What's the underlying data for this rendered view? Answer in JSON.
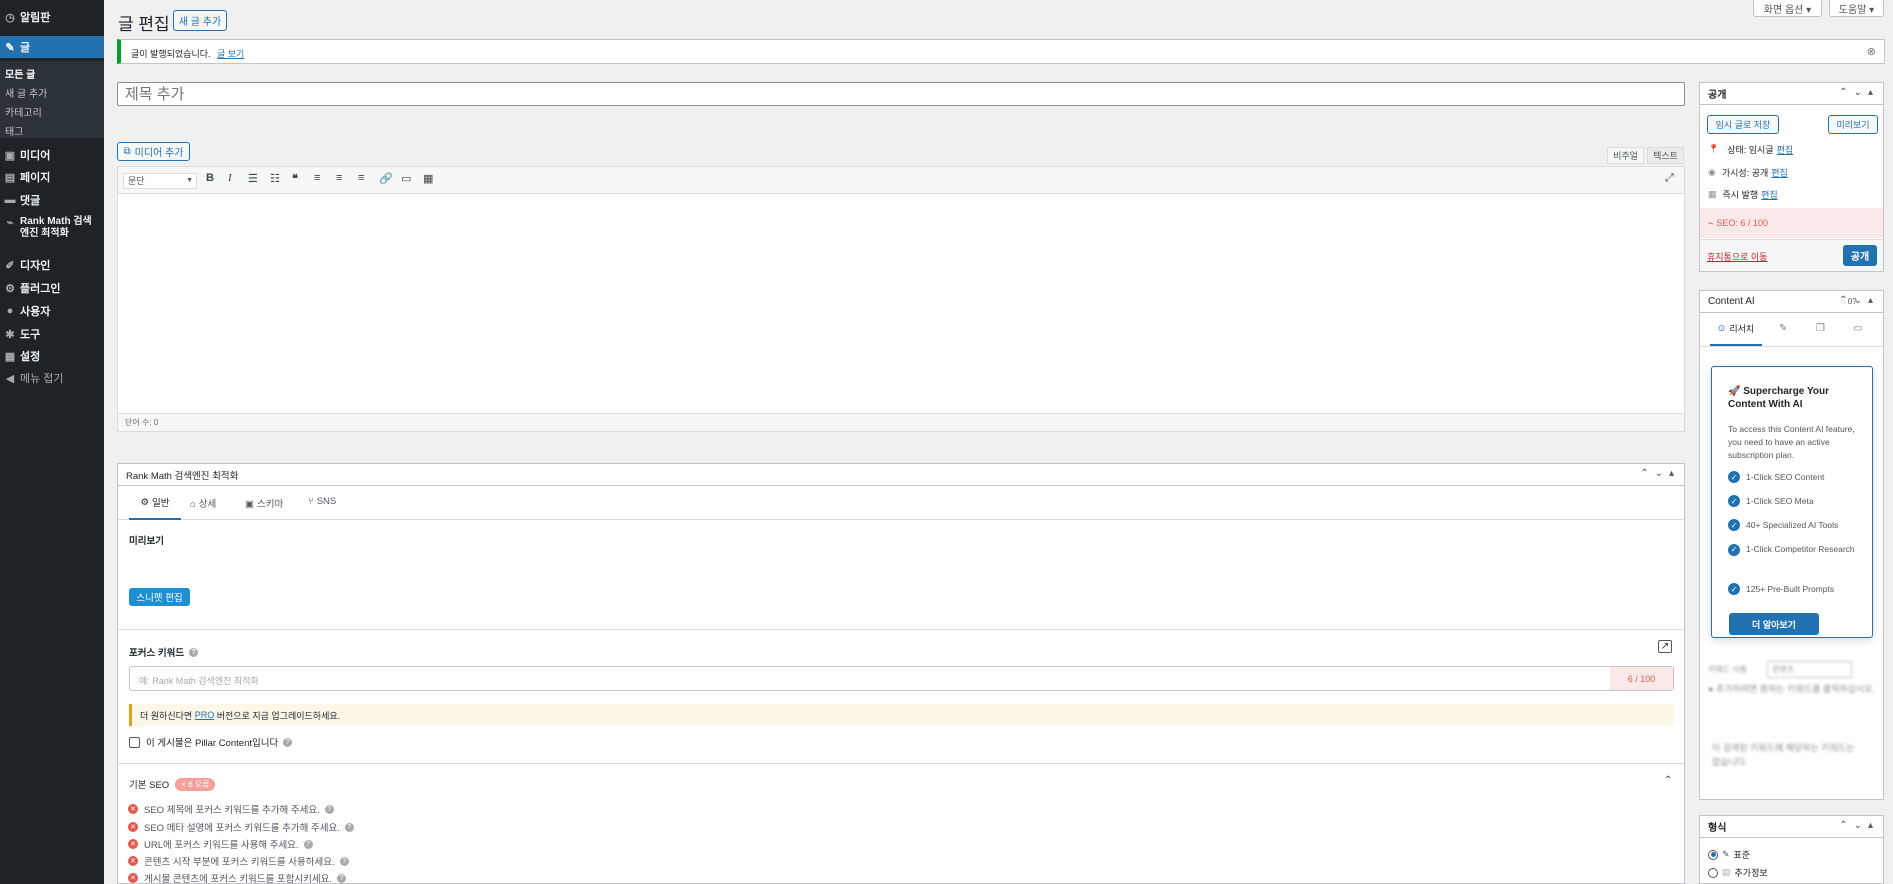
{
  "sidebar": {
    "items": [
      {
        "icon": "dashboard-icon",
        "glyph": "◷",
        "label": "알림판"
      },
      {
        "icon": "pin-icon",
        "glyph": "✎",
        "label": "글"
      },
      {
        "icon": "media-icon",
        "glyph": "▣",
        "label": "미디어"
      },
      {
        "icon": "page-icon",
        "glyph": "▤",
        "label": "페이지"
      },
      {
        "icon": "comment-icon",
        "glyph": "▬",
        "label": "댓글"
      },
      {
        "icon": "rankmath-icon",
        "glyph": "⌁",
        "label": "Rank Math 검색엔진 최적화"
      },
      {
        "icon": "brush-icon",
        "glyph": "✐",
        "label": "디자인"
      },
      {
        "icon": "plugin-icon",
        "glyph": "⚙",
        "label": "플러그인"
      },
      {
        "icon": "user-icon",
        "glyph": "●",
        "label": "사용자"
      },
      {
        "icon": "wrench-icon",
        "glyph": "✱",
        "label": "도구"
      },
      {
        "icon": "settings-icon",
        "glyph": "▦",
        "label": "설정"
      },
      {
        "icon": "collapse-icon",
        "glyph": "◀",
        "label": "메뉴 접기"
      }
    ],
    "submenu": [
      "모든 글",
      "새 글 추가",
      "카테고리",
      "태그"
    ]
  },
  "header": {
    "title": "글 편집",
    "add_new": "새 글 추가",
    "screen_options": "화면 옵션 ▾",
    "help": "도움말 ▾"
  },
  "notice": {
    "text": "글이 발행되었습니다.",
    "link": "글 보기"
  },
  "title_placeholder": "제목 추가",
  "editor": {
    "add_media": "미디어 추가",
    "tab_visual": "비주얼",
    "tab_text": "텍스트",
    "format_select": "문단",
    "word_count": "단어 수: 0"
  },
  "rankmath": {
    "title": "Rank Math 검색엔진 최적화",
    "tabs": [
      "일반",
      "상세",
      "스키마",
      "SNS"
    ],
    "preview_label": "미리보기",
    "snippet_btn": "스니펫 편집",
    "focus_label": "포커스 키워드",
    "focus_placeholder": "예: Rank Math 검색엔진 최적화",
    "focus_score": "6 / 100",
    "upgrade_pre": "더 원하신다면 ",
    "upgrade_link": "PRO",
    "upgrade_post": " 버전으로 지금 업그레이드하세요.",
    "pillar": "이 게시물은 Pillar Content입니다",
    "basic_seo": "기본 SEO",
    "error_badge": "× 6 오류",
    "checks": [
      "SEO 제목에 포커스 키워드를 추가해 주세요.",
      "SEO 메타 설명에 포커스 키워드를 추가해 주세요.",
      "URL에 포커스 키워드를 사용해 주세요.",
      "콘텐츠 시작 부분에 포커스 키워드를 사용하세요.",
      "게시물 콘텐츠에 포커스 키워드를 포함시키세요."
    ]
  },
  "publish": {
    "title": "공개",
    "save_draft": "임시 글로 저장",
    "preview": "미리보기",
    "status_label": "상태: 임시글",
    "visibility_label": "가시성: 공개",
    "schedule_label": "즉시 발행",
    "edit": "편집",
    "seo_score": "SEO: 6 / 100",
    "trash": "휴지통으로 이동",
    "publish_btn": "공개"
  },
  "content_ai": {
    "title": "Content AI",
    "credits": "0",
    "tab_research": "리서치",
    "popup_title": "🚀 Supercharge Your Content With AI",
    "popup_desc": "To access this Content AI feature, you need to have an active subscription plan.",
    "features": [
      "1-Click SEO Content",
      "1-Click SEO Meta",
      "40+ Specialized AI Tools",
      "1-Click Competitor Research",
      "125+ Pre-Built Prompts"
    ],
    "learn_more": "더 알아보기",
    "bg_label": "키워드 사용",
    "bg_select": "콘텐츠",
    "bg_text1": "● 추가하려면 원하는 키워드를 클릭하십시오.",
    "bg_text2": "이 검색된 키워드에 해당하는 키워드는 없습니다."
  },
  "format": {
    "title": "형식",
    "options": [
      "표준",
      "추가정보"
    ]
  },
  "colors": {
    "accent": "#2271b1",
    "sidebar": "#1d2327",
    "error": "#e35950",
    "score_bg": "#fbe9e9"
  }
}
